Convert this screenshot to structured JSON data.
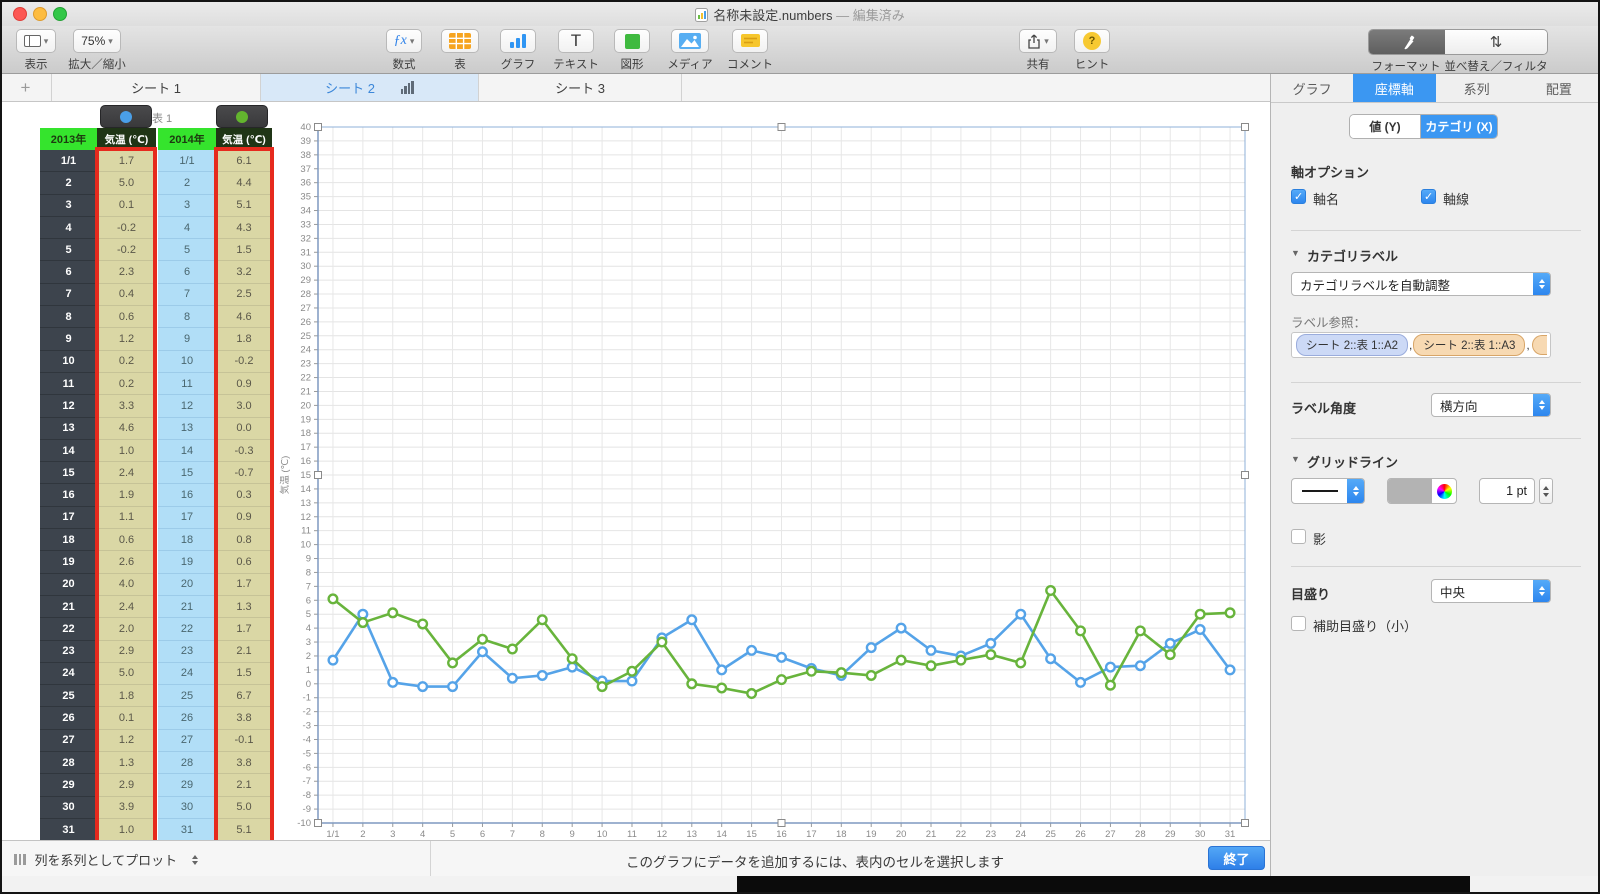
{
  "window": {
    "title": "名称未設定.numbers",
    "status": "— 編集済み"
  },
  "toolbar": {
    "view": "表示",
    "zoom_value": "75%",
    "zoom_label": "拡大／縮小",
    "formula": "数式",
    "table": "表",
    "chart": "グラフ",
    "text": "テキスト",
    "shape": "図形",
    "media": "メディア",
    "comment": "コメント",
    "share": "共有",
    "tips": "ヒント",
    "format": "フォーマット",
    "sort_filter": "並べ替え／フィルタ"
  },
  "sheet_tabs": [
    {
      "label": "シート 1",
      "active": false
    },
    {
      "label": "シート 2",
      "active": true
    },
    {
      "label": "シート 3",
      "active": false
    }
  ],
  "table": {
    "badge": "表 1",
    "groups": [
      {
        "year": "2013年",
        "temp_header": "気温 (℃)",
        "dot_color": "#4A9FE8"
      },
      {
        "year": "2014年",
        "temp_header": "気温 (℃)",
        "dot_color": "#63B52E"
      }
    ],
    "row_labels": [
      "1/1",
      "2",
      "3",
      "4",
      "5",
      "6",
      "7",
      "8",
      "9",
      "10",
      "11",
      "12",
      "13",
      "14",
      "15",
      "16",
      "17",
      "18",
      "19",
      "20",
      "21",
      "22",
      "23",
      "24",
      "25",
      "26",
      "27",
      "28",
      "29",
      "30",
      "31"
    ],
    "values_2013": [
      "1.7",
      "5.0",
      "0.1",
      "-0.2",
      "-0.2",
      "2.3",
      "0.4",
      "0.6",
      "1.2",
      "0.2",
      "0.2",
      "3.3",
      "4.6",
      "1.0",
      "2.4",
      "1.9",
      "1.1",
      "0.6",
      "2.6",
      "4.0",
      "2.4",
      "2.0",
      "2.9",
      "5.0",
      "1.8",
      "0.1",
      "1.2",
      "1.3",
      "2.9",
      "3.9",
      "1.0"
    ],
    "values_2014": [
      "6.1",
      "4.4",
      "5.1",
      "4.3",
      "1.5",
      "3.2",
      "2.5",
      "4.6",
      "1.8",
      "-0.2",
      "0.9",
      "3.0",
      "0.0",
      "-0.3",
      "-0.7",
      "0.3",
      "0.9",
      "0.8",
      "0.6",
      "1.7",
      "1.3",
      "1.7",
      "2.1",
      "1.5",
      "6.7",
      "3.8",
      "-0.1",
      "3.8",
      "2.1",
      "5.0",
      "5.1"
    ]
  },
  "chart_data": {
    "type": "line",
    "categories": [
      "1/1",
      "2",
      "3",
      "4",
      "5",
      "6",
      "7",
      "8",
      "9",
      "10",
      "11",
      "12",
      "13",
      "14",
      "15",
      "16",
      "17",
      "18",
      "19",
      "20",
      "21",
      "22",
      "23",
      "24",
      "25",
      "26",
      "27",
      "28",
      "29",
      "30",
      "31"
    ],
    "series": [
      {
        "name": "2013年 気温 (℃)",
        "color": "#55A3E8",
        "values": [
          1.7,
          5.0,
          0.1,
          -0.2,
          -0.2,
          2.3,
          0.4,
          0.6,
          1.2,
          0.2,
          0.2,
          3.3,
          4.6,
          1.0,
          2.4,
          1.9,
          1.1,
          0.6,
          2.6,
          4.0,
          2.4,
          2.0,
          2.9,
          5.0,
          1.8,
          0.1,
          1.2,
          1.3,
          2.9,
          3.9,
          1.0
        ]
      },
      {
        "name": "2014年 気温 (℃)",
        "color": "#68B43C",
        "values": [
          6.1,
          4.4,
          5.1,
          4.3,
          1.5,
          3.2,
          2.5,
          4.6,
          1.8,
          -0.2,
          0.9,
          3.0,
          0.0,
          -0.3,
          -0.7,
          0.3,
          0.9,
          0.8,
          0.6,
          1.7,
          1.3,
          1.7,
          2.1,
          1.5,
          6.7,
          3.8,
          -0.1,
          3.8,
          2.1,
          5.0,
          5.1
        ]
      }
    ],
    "title": "",
    "xlabel": "",
    "ylabel": "気温 (℃)",
    "ylim": [
      -10,
      40
    ],
    "ytick_step": 1,
    "grid": true,
    "marker": "circle",
    "legend_position": "none"
  },
  "inspector": {
    "tabs": [
      "グラフ",
      "座標軸",
      "系列",
      "配置"
    ],
    "active_tab": "座標軸",
    "axis_segments": [
      "値 (Y)",
      "カテゴリ (X)"
    ],
    "active_segment": "カテゴリ (X)",
    "axis_options_title": "軸オプション",
    "axis_name_label": "軸名",
    "axis_name_checked": true,
    "axis_line_label": "軸線",
    "axis_line_checked": true,
    "category_labels_title": "カテゴリラベル",
    "category_labels_value": "カテゴリラベルを自動調整",
    "label_ref_label": "ラベル参照：",
    "token_separator": ",",
    "label_tokens": [
      {
        "text": "シート 2::表 1::A2",
        "style": "blue"
      },
      {
        "text": "シート 2::表 1::A3",
        "style": "orange"
      }
    ],
    "label_angle_label": "ラベル角度",
    "label_angle_value": "横方向",
    "gridlines_title": "グリッドライン",
    "gridline_width": "1 pt",
    "shadow_label": "影",
    "shadow_checked": false,
    "ticks_label": "目盛り",
    "ticks_value": "中央",
    "minor_ticks_label": "補助目盛り（小）",
    "minor_ticks_checked": false
  },
  "bottom_bar": {
    "plot_mode": "列を系列としてプロット",
    "hint": "このグラフにデータを追加するには、表内のセルを選択します",
    "done": "終了"
  }
}
